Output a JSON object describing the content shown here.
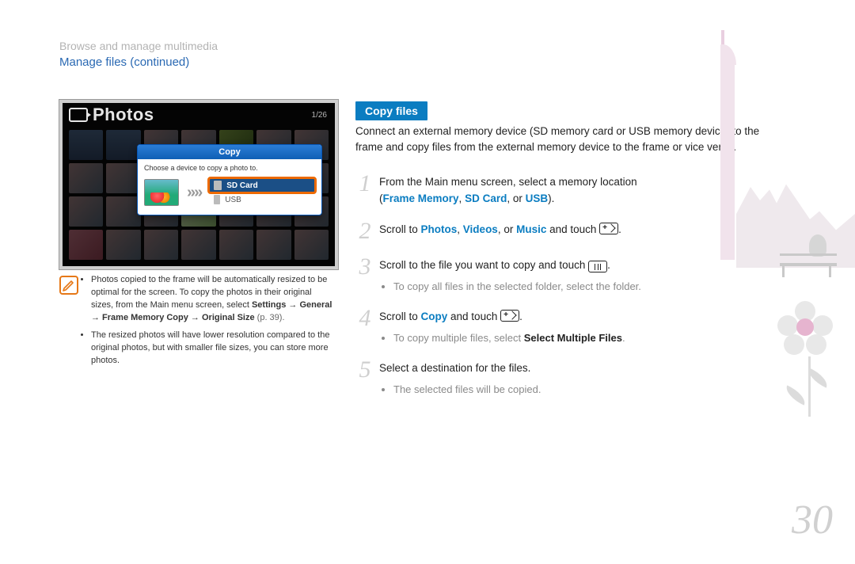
{
  "breadcrumb": "Browse and manage multimedia",
  "section_title": "Manage files  (continued)",
  "page_number": "30",
  "screenshot": {
    "app_title": "Photos",
    "counter": "1/26",
    "dialog": {
      "title": "Copy",
      "message": "Choose a device to copy a photo to.",
      "arrows": "»»",
      "options": [
        {
          "label": "SD Card",
          "selected": true
        },
        {
          "label": "USB",
          "selected": false
        }
      ]
    }
  },
  "note": {
    "items": [
      {
        "pre": "Photos copied to the frame will be automatically resized to be optimal for the screen. To copy the photos in their original sizes, from the Main menu screen, select ",
        "bold": "Settings → General → Frame Memory Copy → Original Size",
        "post_gray": " (p. 39)."
      },
      {
        "pre": "The resized photos will have lower resolution compared to the original photos, but with smaller file sizes, you can store more photos."
      }
    ]
  },
  "right": {
    "heading": "Copy files",
    "intro": "Connect an external memory device (SD memory card or USB memory device) to the frame and copy files from the external memory device to the frame or vice versa.",
    "steps": [
      {
        "n": "1",
        "line": "From the Main menu screen, select a memory location",
        "line2_pre": "(",
        "opts": [
          {
            "t": "Frame Memory"
          },
          {
            "sep": ", "
          },
          {
            "t": "SD Card"
          },
          {
            "sep": ", or "
          },
          {
            "t": "USB"
          }
        ],
        "line2_post": ")."
      },
      {
        "n": "2",
        "pre": "Scroll to ",
        "opts": [
          {
            "t": "Photos"
          },
          {
            "sep": ", "
          },
          {
            "t": "Videos"
          },
          {
            "sep": ", or "
          },
          {
            "t": "Music"
          }
        ],
        "post": " and touch ",
        "icon": "enter",
        "tail": "."
      },
      {
        "n": "3",
        "text": "Scroll to the file you want to copy and touch ",
        "icon": "menu",
        "tail": ".",
        "sub": [
          {
            "t": "To copy all files in the selected folder, select the folder."
          }
        ]
      },
      {
        "n": "4",
        "pre": "Scroll to ",
        "opts": [
          {
            "tb": "Copy"
          }
        ],
        "post": " and touch ",
        "icon": "enter",
        "tail": ".",
        "sub": [
          {
            "t": "To copy multiple files, select ",
            "b": "Select Multiple Files",
            "t2": "."
          }
        ]
      },
      {
        "n": "5",
        "text": "Select a destination for the files.",
        "sub": [
          {
            "t": "The selected files will be copied."
          }
        ]
      }
    ]
  }
}
